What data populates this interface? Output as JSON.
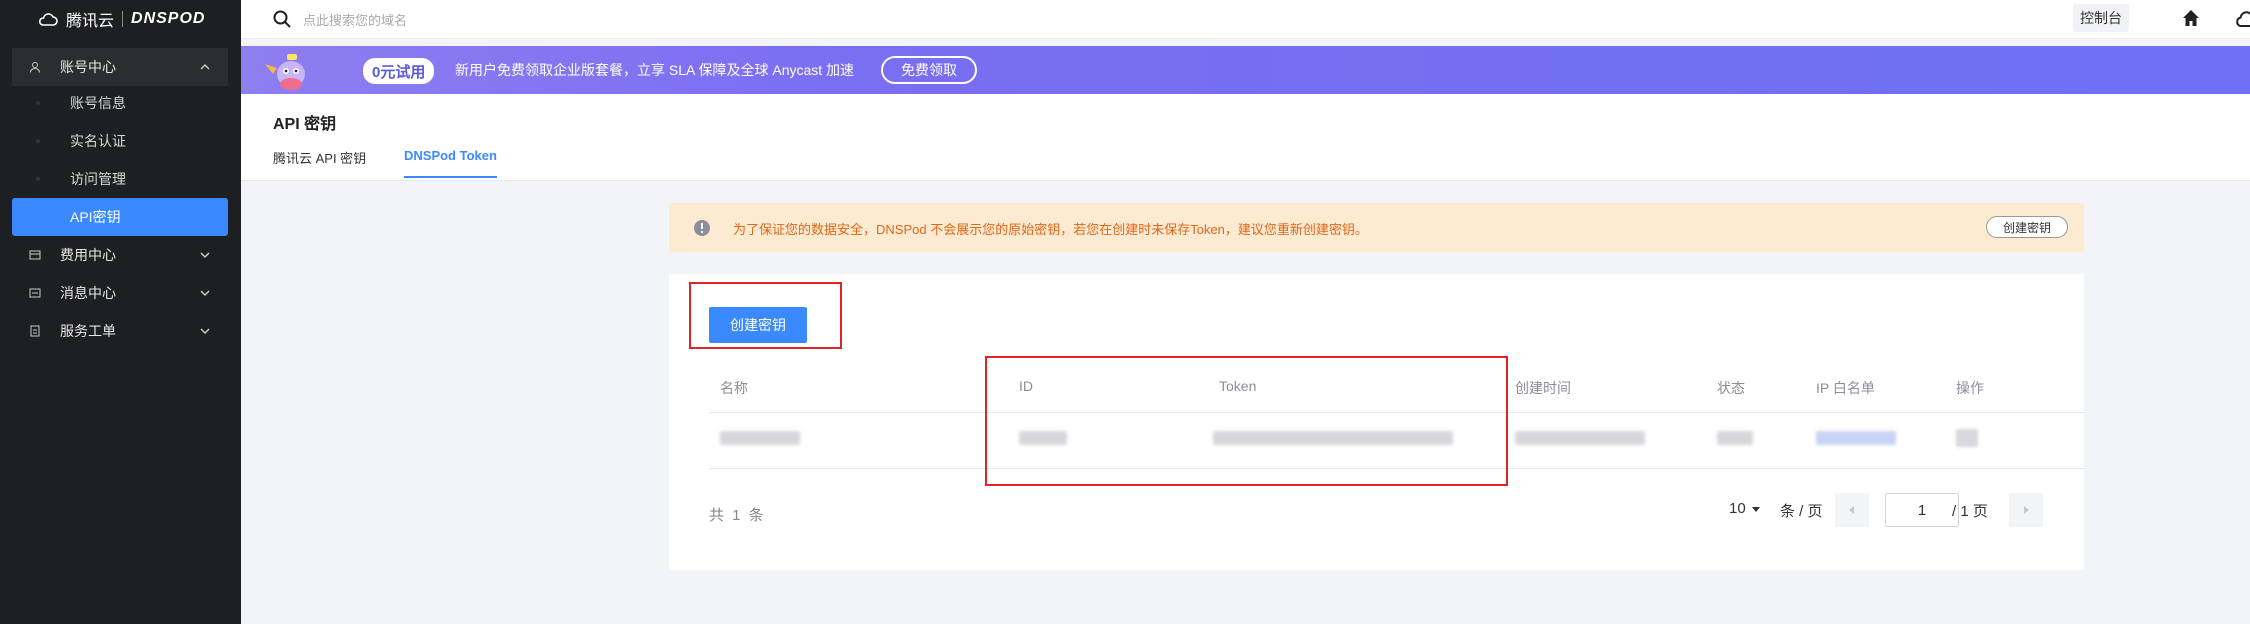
{
  "sidebar": {
    "logo_text": "腾讯云",
    "brand": "DNSPOD",
    "groups": [
      {
        "label": "账号中心"
      },
      {
        "label": "费用中心"
      },
      {
        "label": "消息中心"
      },
      {
        "label": "服务工单"
      }
    ],
    "items": [
      {
        "label": "账号信息"
      },
      {
        "label": "实名认证"
      },
      {
        "label": "访问管理"
      },
      {
        "label": "API密钥"
      }
    ]
  },
  "topbar": {
    "search_placeholder": "点此搜索您的域名",
    "console_label": "控制台"
  },
  "banner": {
    "trial_label": "0元试用",
    "text": "新用户免费领取企业版套餐，立享 SLA 保障及全球 Anycast 加速",
    "button_label": "免费领取"
  },
  "page": {
    "title": "API 密钥",
    "tabs": [
      {
        "label": "腾讯云 API 密钥"
      },
      {
        "label": "DNSPod Token"
      }
    ]
  },
  "notice": {
    "text": "为了保证您的数据安全，DNSPod 不会展示您的原始密钥，若您在创建时未保存Token，建议您重新创建密钥。",
    "button_label": "创建密钥"
  },
  "table": {
    "create_button": "创建密钥",
    "headers": [
      "名称",
      "ID",
      "Token",
      "创建时间",
      "状态",
      "IP 白名单",
      "操作"
    ]
  },
  "pagination": {
    "total_label": "共 1 条",
    "page_size": "10",
    "per_page_label": "条 / 页",
    "current_page": "1",
    "total_pages_label": "/ 1 页"
  },
  "colors": {
    "sidebar_bg": "#1e1f22",
    "accent": "#3b89ff",
    "notice_bg": "#fdebd1",
    "notice_text": "#e0661b",
    "highlight": "#e02424"
  }
}
